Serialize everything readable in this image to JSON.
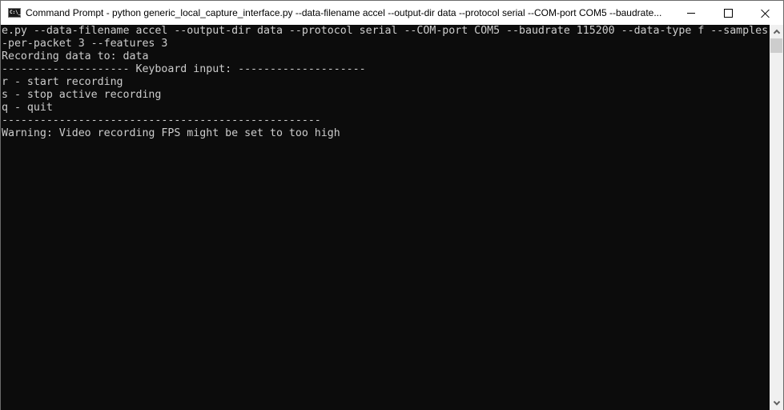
{
  "window": {
    "title": "Command Prompt - python  generic_local_capture_interface.py --data-filename accel --output-dir data --protocol serial --COM-port COM5 --baudrate...",
    "icon": "cmd-icon",
    "icon_text": "C:\\_",
    "controls": {
      "minimize": "minimize-icon",
      "maximize": "maximize-icon",
      "close": "close-icon"
    }
  },
  "console": {
    "lines": [
      "e.py --data-filename accel --output-dir data --protocol serial --COM-port COM5 --baudrate 115200 --data-type f --samples",
      "-per-packet 3 --features 3",
      "Recording data to: data",
      "-------------------- Keyboard input: --------------------",
      "r - start recording",
      "s - stop active recording",
      "q - quit",
      "--------------------------------------------------",
      "Warning: Video recording FPS might be set to too high"
    ],
    "colors": {
      "background": "#0c0c0c",
      "foreground": "#cccccc"
    }
  },
  "scrollbar": {
    "up": "chevron-up-icon",
    "down": "chevron-down-icon"
  }
}
